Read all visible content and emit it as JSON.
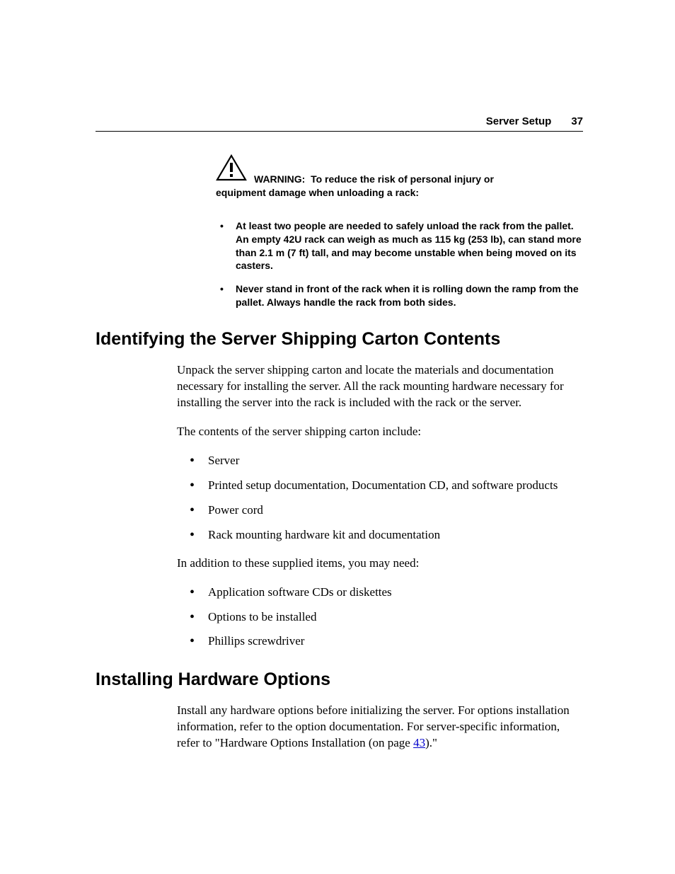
{
  "header": {
    "section": "Server Setup",
    "page_number": "37"
  },
  "warning": {
    "label": "WARNING:",
    "intro": "To reduce the risk of personal injury or equipment damage when unloading a rack:",
    "bullets": [
      "At least two people are needed to safely unload the rack from the pallet. An empty 42U rack can weigh as much as 115 kg (253 lb), can stand more than 2.1 m (7 ft) tall, and may become unstable when being moved on its casters.",
      "Never stand in front of the rack when it is rolling down the ramp from the pallet. Always handle the rack from both sides."
    ]
  },
  "section1": {
    "title": "Identifying the Server Shipping Carton Contents",
    "p1": "Unpack the server shipping carton and locate the materials and documentation necessary for installing the server. All the rack mounting hardware necessary for installing the server into the rack is included with the rack or the server.",
    "p2": "The contents of the server shipping carton include:",
    "list1": [
      "Server",
      "Printed setup documentation, Documentation CD, and software products",
      "Power cord",
      "Rack mounting hardware kit and documentation"
    ],
    "p3": "In addition to these supplied items, you may need:",
    "list2": [
      "Application software CDs or diskettes",
      "Options to be installed",
      "Phillips screwdriver"
    ]
  },
  "section2": {
    "title": "Installing Hardware Options",
    "p1_pre": "Install any hardware options before initializing the server. For options installation information, refer to the option documentation. For server-specific information, refer to \"Hardware Options Installation (on page ",
    "link": "43",
    "p1_post": ").\""
  }
}
